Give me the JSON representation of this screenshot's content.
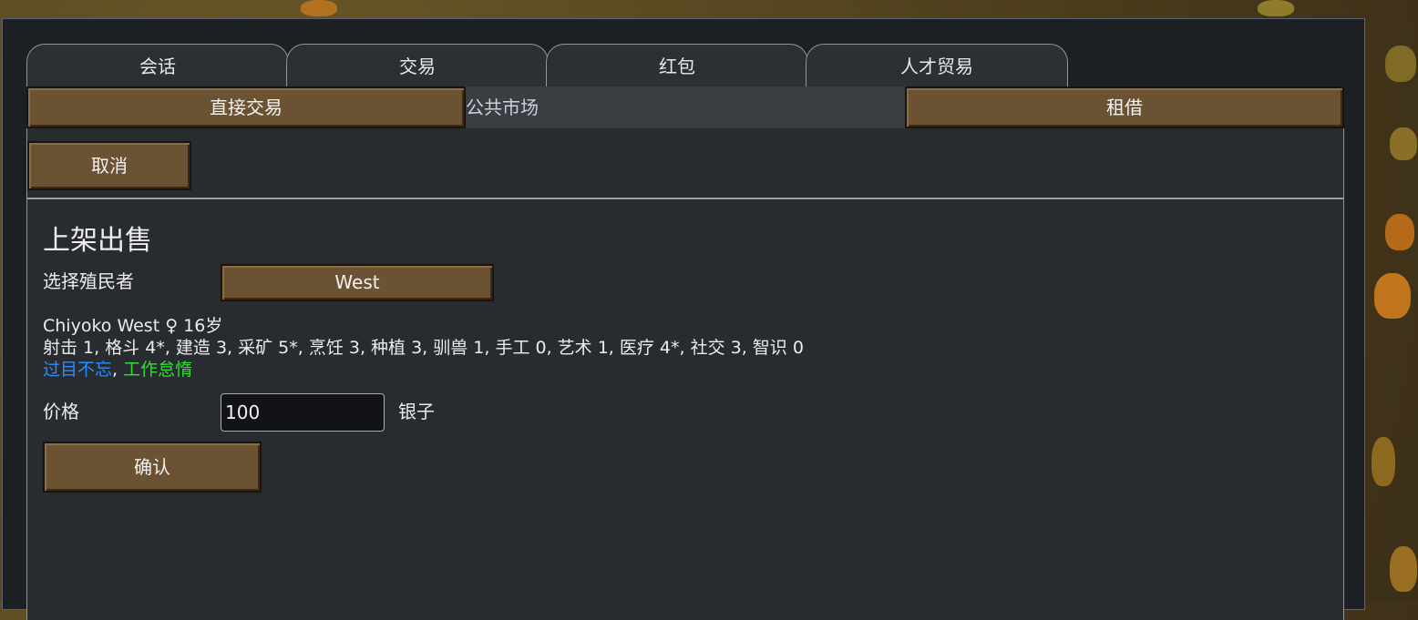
{
  "tabs": [
    {
      "label": "会话"
    },
    {
      "label": "交易"
    },
    {
      "label": "红包"
    },
    {
      "label": "人才贸易"
    }
  ],
  "subtabs": {
    "direct_trade": "直接交易",
    "public_market": "公共市场",
    "lease": "租借"
  },
  "cancel_label": "取消",
  "listing": {
    "heading": "上架出售",
    "select_colonist_label": "选择殖民者",
    "selected_colonist": "West",
    "colonist_summary": "Chiyoko West ♀ 16岁",
    "skills": "射击 1, 格斗 4*, 建造 3, 采矿 5*, 烹饪 3, 种植 3, 驯兽 1, 手工 0, 艺术 1, 医疗 4*, 社交 3, 智识 0",
    "traits": [
      {
        "name": "过目不忘",
        "color": "#2a8cff"
      },
      {
        "name": "工作怠惰",
        "color": "#2fe02f"
      }
    ],
    "trait_separator": ", ",
    "price_label": "价格",
    "price_value": "100",
    "currency": "银子",
    "confirm_label": "确认"
  }
}
